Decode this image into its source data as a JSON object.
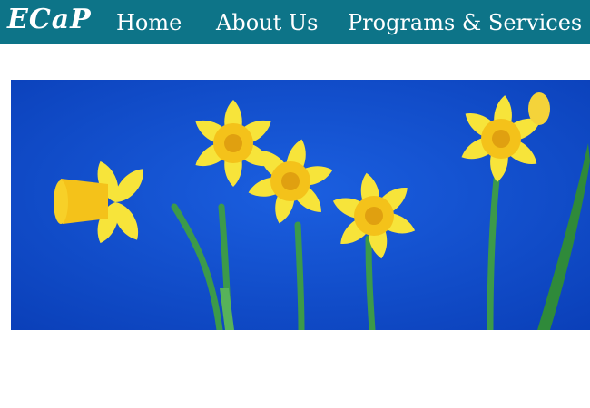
{
  "header": {
    "logo_text": "ECaP",
    "nav": [
      {
        "label": "Home"
      },
      {
        "label": "About Us"
      },
      {
        "label": "Programs & Services"
      }
    ]
  },
  "hero": {
    "image": "daffodils-on-blue",
    "colors": {
      "sky": "#0a48c8",
      "petal": "#f7e43a",
      "trumpet": "#f4c21a",
      "stem": "#3c9a4a"
    }
  },
  "colors": {
    "navbar": "#0d7488",
    "nav_text": "#ffffff",
    "background": "#ffffff"
  }
}
